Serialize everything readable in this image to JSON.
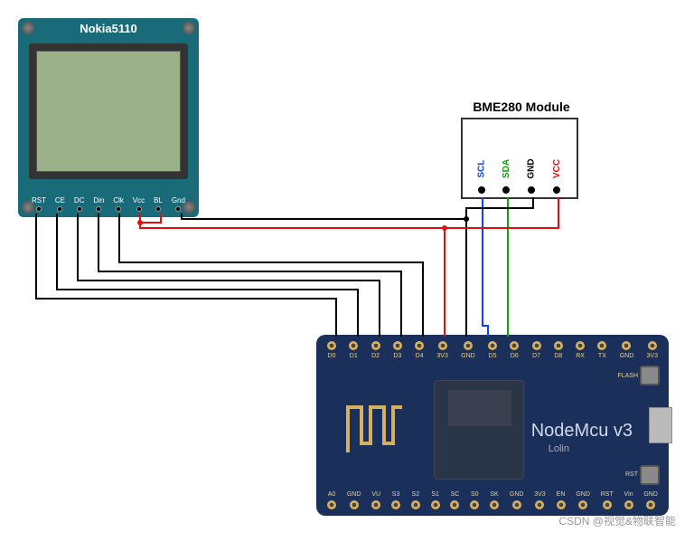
{
  "nokia": {
    "title": "Nokia5110",
    "pins": [
      "RST",
      "CE",
      "DC",
      "Din",
      "Clk",
      "Vcc",
      "BL",
      "Gnd"
    ]
  },
  "bme": {
    "title": "BME280 Module",
    "pins": [
      {
        "name": "SCL",
        "color": "#1040ff"
      },
      {
        "name": "SDA",
        "color": "#10a010"
      },
      {
        "name": "GND",
        "color": "#000000"
      },
      {
        "name": "VCC",
        "color": "#e01010"
      }
    ]
  },
  "mcu": {
    "name": "NodeMcu v3",
    "subtitle": "Lolin",
    "btn_flash": "FLASH",
    "btn_rst": "RST",
    "top_pins": [
      "D0",
      "D1",
      "D2",
      "D3",
      "D4",
      "3V3",
      "GND",
      "D5",
      "D6",
      "D7",
      "D8",
      "RX",
      "TX",
      "GND",
      "3V3"
    ],
    "bottom_pins": [
      "A0",
      "GND",
      "VU",
      "S3",
      "S2",
      "S1",
      "SC",
      "S0",
      "SK",
      "GND",
      "3V3",
      "EN",
      "GND",
      "RST",
      "Vin",
      "GND"
    ]
  },
  "wiring": {
    "description": "Nokia5110 RST→D0, CE→D1, DC→D2, Din→D3, Clk→D4, Vcc/BL→3V3, Gnd→GND; BME280 SCL→D5, SDA→D6, GND→GND, VCC→3V3"
  },
  "watermark": "CSDN @视觉&物联智能"
}
